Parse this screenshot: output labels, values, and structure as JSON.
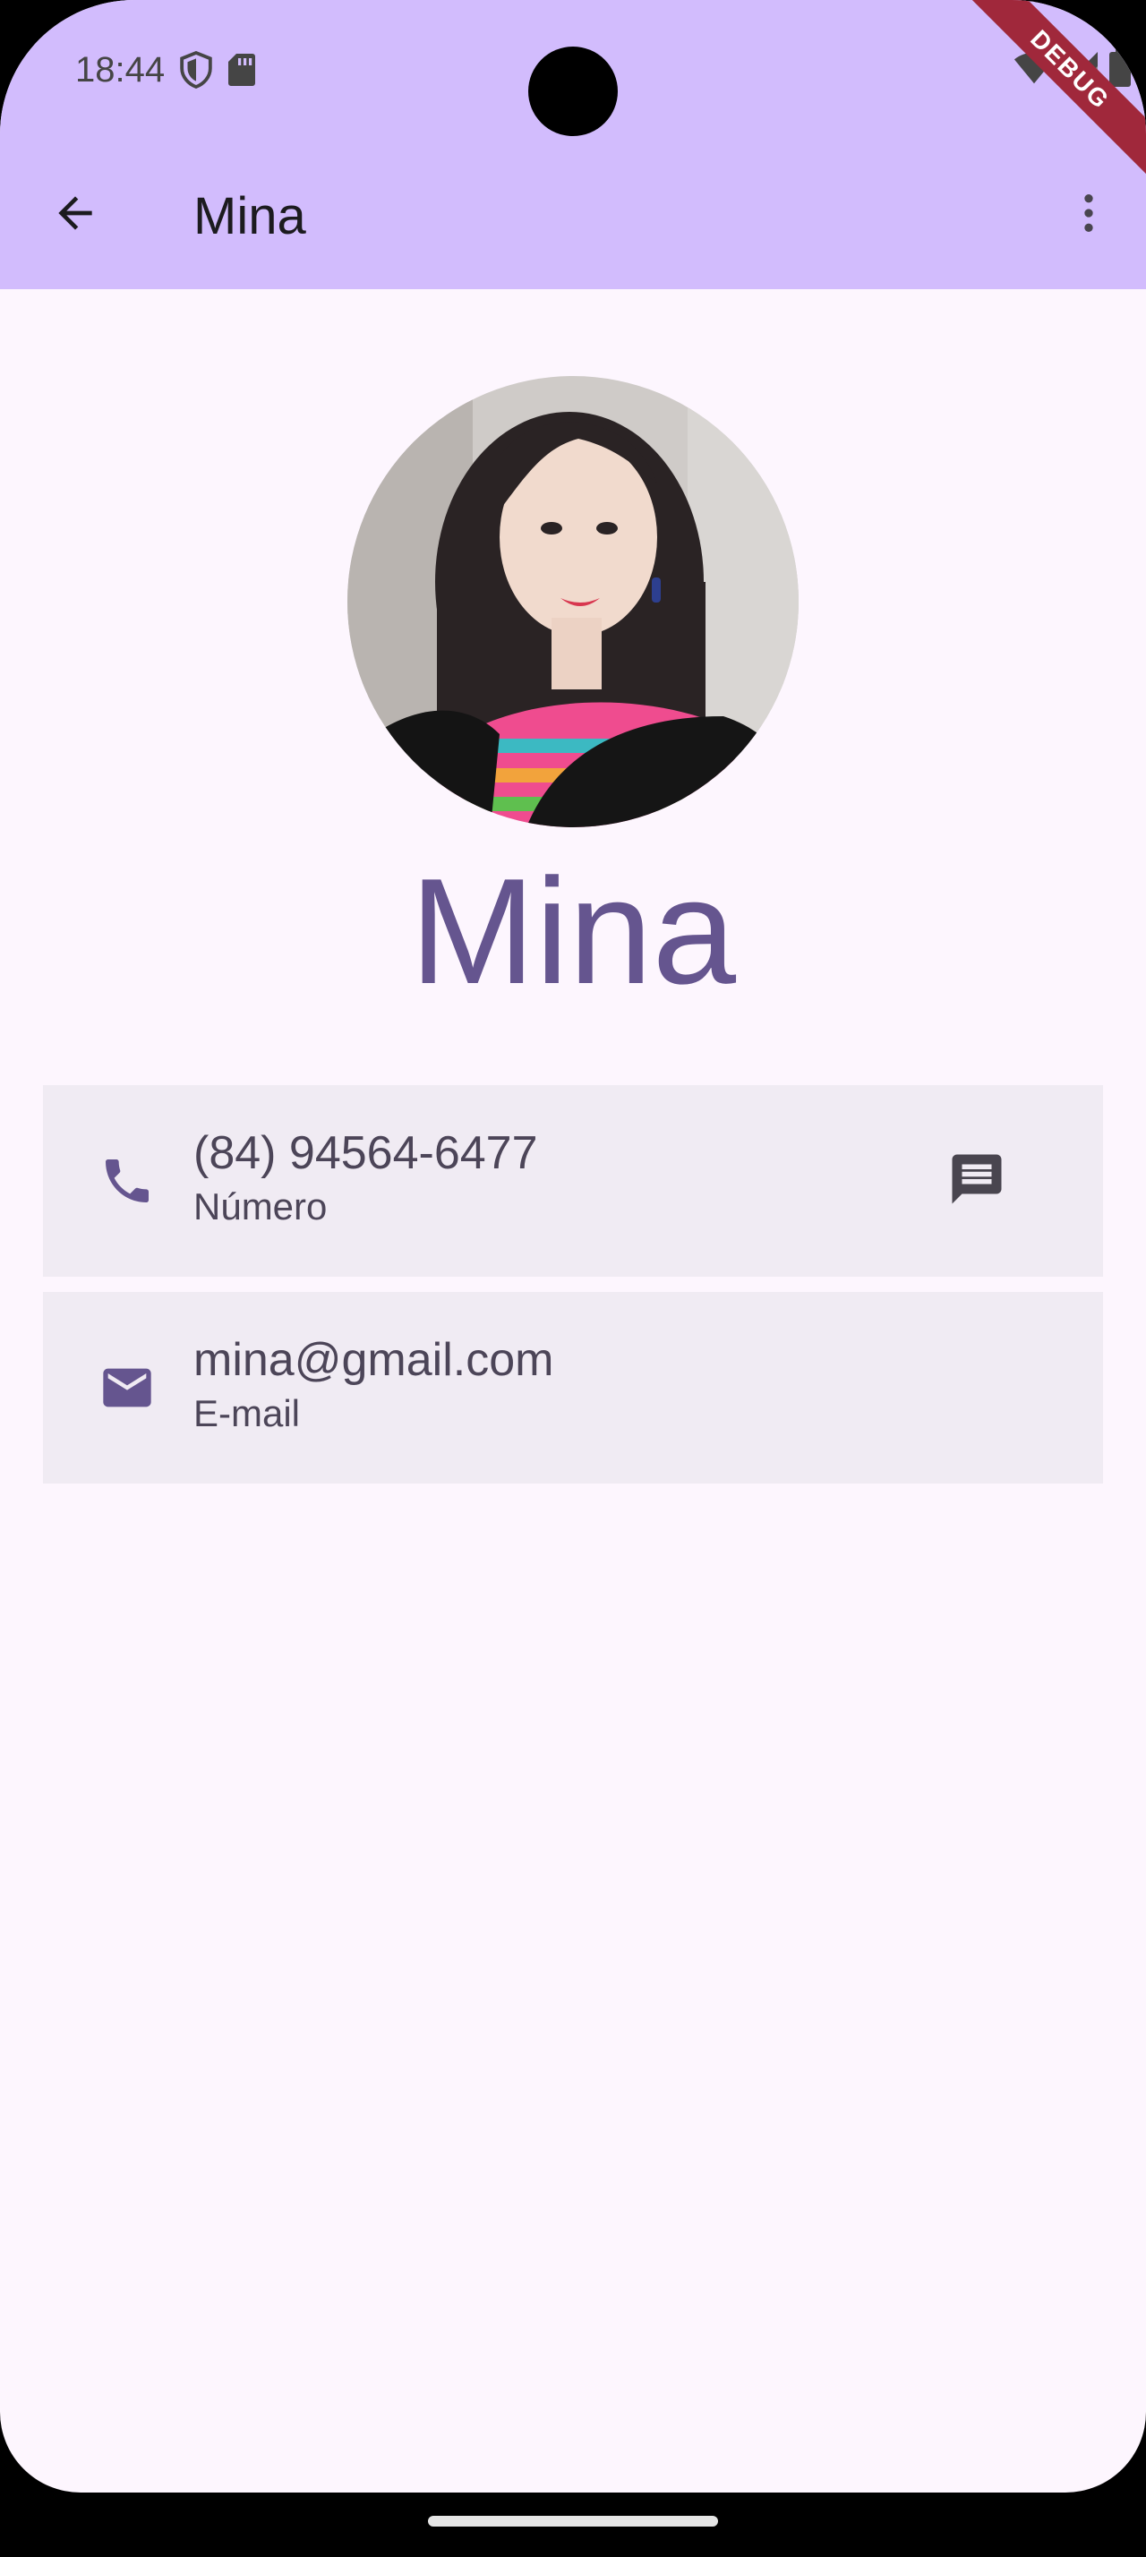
{
  "status_bar": {
    "time": "18:44",
    "left_icons": [
      "shield-icon",
      "sd-card-icon"
    ],
    "right_icons": [
      "wifi-icon",
      "signal-icon",
      "battery-icon"
    ],
    "debug_label": "DEBUG"
  },
  "app_bar": {
    "title": "Mina",
    "back_icon": "arrow-back-icon",
    "menu_icon": "more-vert-icon"
  },
  "contact": {
    "name": "Mina",
    "photo": "contact-photo"
  },
  "phone_card": {
    "value": "(84) 94564-6477",
    "label": "Número",
    "icon": "phone-icon",
    "action_icon": "message-icon"
  },
  "email_card": {
    "value": "mina@gmail.com",
    "label": "E-mail",
    "icon": "mail-icon"
  },
  "colors": {
    "app_bar": "#d2bcfd",
    "background": "#fdf6fe",
    "accent": "#65558f",
    "card": "#f0ebf3",
    "debug_ribbon": "#a0283b"
  }
}
